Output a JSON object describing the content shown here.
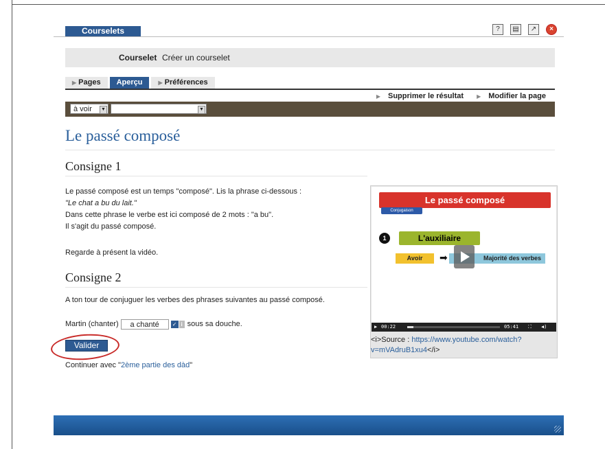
{
  "app": {
    "brand": "Courselets"
  },
  "top_icons": [
    "help-icon",
    "print-icon",
    "popup-icon",
    "close-icon"
  ],
  "subnav": {
    "current": "Courselet",
    "create_link": "Créer un courselet"
  },
  "tabs": [
    {
      "label": "Pages",
      "active": false
    },
    {
      "label": "Aperçu",
      "active": true
    },
    {
      "label": "Préférences",
      "active": false
    }
  ],
  "actions": {
    "delete_result": "Supprimer le résultat",
    "edit_page": "Modifier la page"
  },
  "selectors": {
    "filter_value": "à voir",
    "page_value": ""
  },
  "page": {
    "title": "Le passé composé",
    "consigne1": {
      "heading": "Consigne 1",
      "line1": "Le passé composé est un temps \"composé\". Lis la phrase ci-dessous :",
      "line2": "\"Le chat a bu du lait.\"",
      "line3": "Dans cette phrase le verbe est ici composé de 2 mots : \"a bu\".",
      "line4": "Il s'agit du passé composé.",
      "line5": "Regarde à présent la vidéo."
    },
    "consigne2": {
      "heading": "Consigne 2",
      "instruction": "A ton tour de conjuguer les verbes des phrases suivantes au passé composé.",
      "sentence_before": "Martin (chanter)",
      "answer": "a chanté",
      "sentence_after": "sous sa douche."
    },
    "validate_label": "Valider",
    "continue_prefix": "Continuer avec \"",
    "continue_link": "2ème partie des dàd",
    "continue_suffix": "\""
  },
  "video": {
    "title": "Le passé composé",
    "tag": "Conjugaison",
    "step_number": "1",
    "step_title": "L'auxiliaire",
    "avoir": "Avoir",
    "majorite": "Majorité des verbes",
    "current_time": "00:22",
    "duration": "05:41",
    "progress": 0.064,
    "source_prefix": "<i>Source : ",
    "source_url": "https://www.youtube.com/watch?v=mVAdruB1xu4",
    "source_suffix": "</i>"
  },
  "colors": {
    "accent_blue": "#2d5a92",
    "link_blue": "#2a5f9b",
    "selector_bar": "#5a4e3c",
    "annotation_red": "#c82a28"
  }
}
